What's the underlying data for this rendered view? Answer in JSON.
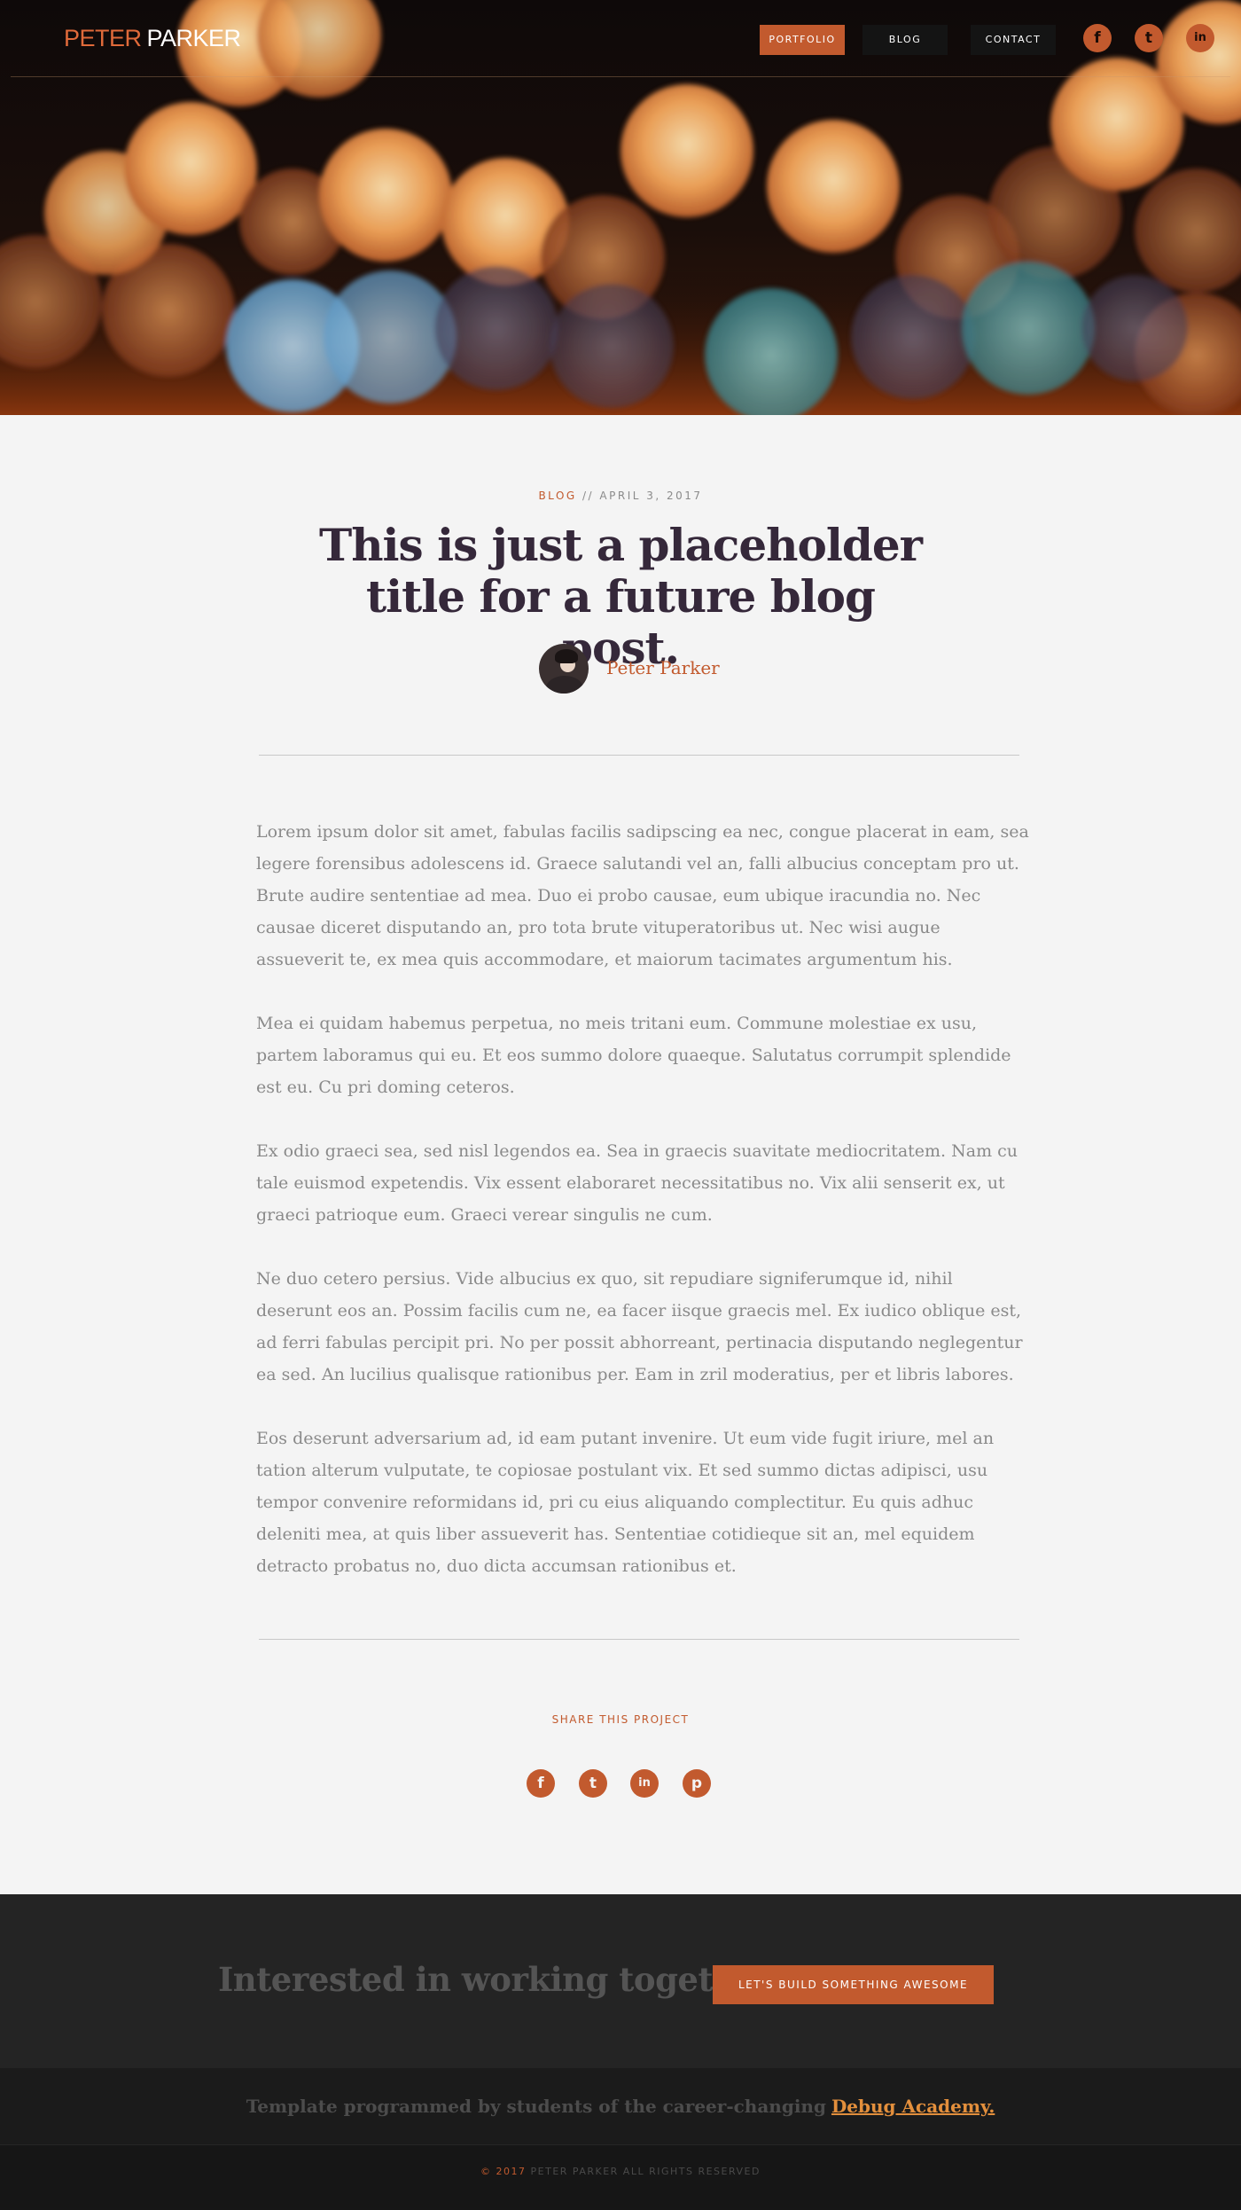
{
  "nav": {
    "logo_first": "PETER",
    "logo_last": "PARKER",
    "items": [
      {
        "label": "PORTFOLIO",
        "active": true
      },
      {
        "label": "BLOG",
        "active": false
      },
      {
        "label": "CONTACT",
        "active": false
      }
    ],
    "social": [
      {
        "icon": "facebook-icon",
        "glyph": "f"
      },
      {
        "icon": "twitter-icon",
        "glyph": "t"
      },
      {
        "icon": "linkedin-icon",
        "glyph": "in"
      }
    ]
  },
  "post": {
    "category": "BLOG",
    "separator": " // ",
    "date": "APRIL 3, 2017",
    "title": "This is just a placeholder title for a future blog post.",
    "author": "Peter Parker",
    "paragraphs": [
      "Lorem ipsum dolor sit amet, fabulas facilis sadipscing ea nec, congue placerat in eam, sea legere forensibus adolescens id. Graece salutandi vel an, falli albucius conceptam pro ut. Brute audire sententiae ad mea. Duo ei probo causae, eum ubique iracundia no. Nec causae diceret disputando an, pro tota brute vituperatoribus ut. Nec wisi augue assueverit te, ex mea quis accommodare, et maiorum tacimates argumentum his.",
      "Mea ei quidam habemus perpetua, no meis tritani eum. Commune molestiae ex usu, partem laboramus qui eu. Et eos summo dolore quaeque. Salutatus corrumpit splendide est eu. Cu pri doming ceteros.",
      "Ex odio graeci sea, sed nisl legendos ea. Sea in graecis suavitate mediocritatem. Nam cu tale euismod expetendis. Vix essent elaboraret necessitatibus no. Vix alii senserit ex, ut graeci patrioque eum. Graeci verear singulis ne cum.",
      "Ne duo cetero persius. Vide albucius ex quo, sit repudiare signiferumque id, nihil deserunt eos an. Possim facilis cum ne, ea facer iisque graecis mel. Ex iudico oblique est, ad ferri fabulas percipit pri. No per possit abhorreant, pertinacia disputando neglegentur ea sed. An lucilius qualisque rationibus per. Eam in zril moderatius, per et libris labores.",
      "Eos deserunt adversarium ad, id eam putant invenire. Ut eum vide fugit iriure, mel an tation alterum vulputate, te copiosae postulant vix. Et sed summo dictas adipisci, usu tempor convenire reformidans id, pri cu eius aliquando complectitur. Eu quis adhuc deleniti mea, at quis liber assueverit has. Sententiae cotidieque sit an, mel equidem detracto probatus no, duo dicta accumsan rationibus et."
    ]
  },
  "share": {
    "label": "SHARE THIS PROJECT",
    "icons": [
      {
        "icon": "facebook-icon",
        "glyph": "f"
      },
      {
        "icon": "twitter-icon",
        "glyph": "t"
      },
      {
        "icon": "linkedin-icon",
        "glyph": "in"
      },
      {
        "icon": "pinterest-icon",
        "glyph": "p"
      }
    ]
  },
  "cta": {
    "text": "Interested in working together?",
    "button": "LET'S BUILD SOMETHING AWESOME"
  },
  "credit": {
    "text": "Template programmed by students of the career-changing",
    "link": "Debug Academy."
  },
  "footer": {
    "year": "© 2017",
    "text": "PETER PARKER ALL RIGHTS RESERVED"
  },
  "colors": {
    "accent": "#c25a2e",
    "heading": "#35283a",
    "body_text": "#8a8a8a",
    "link_gold": "#e38f3c"
  }
}
